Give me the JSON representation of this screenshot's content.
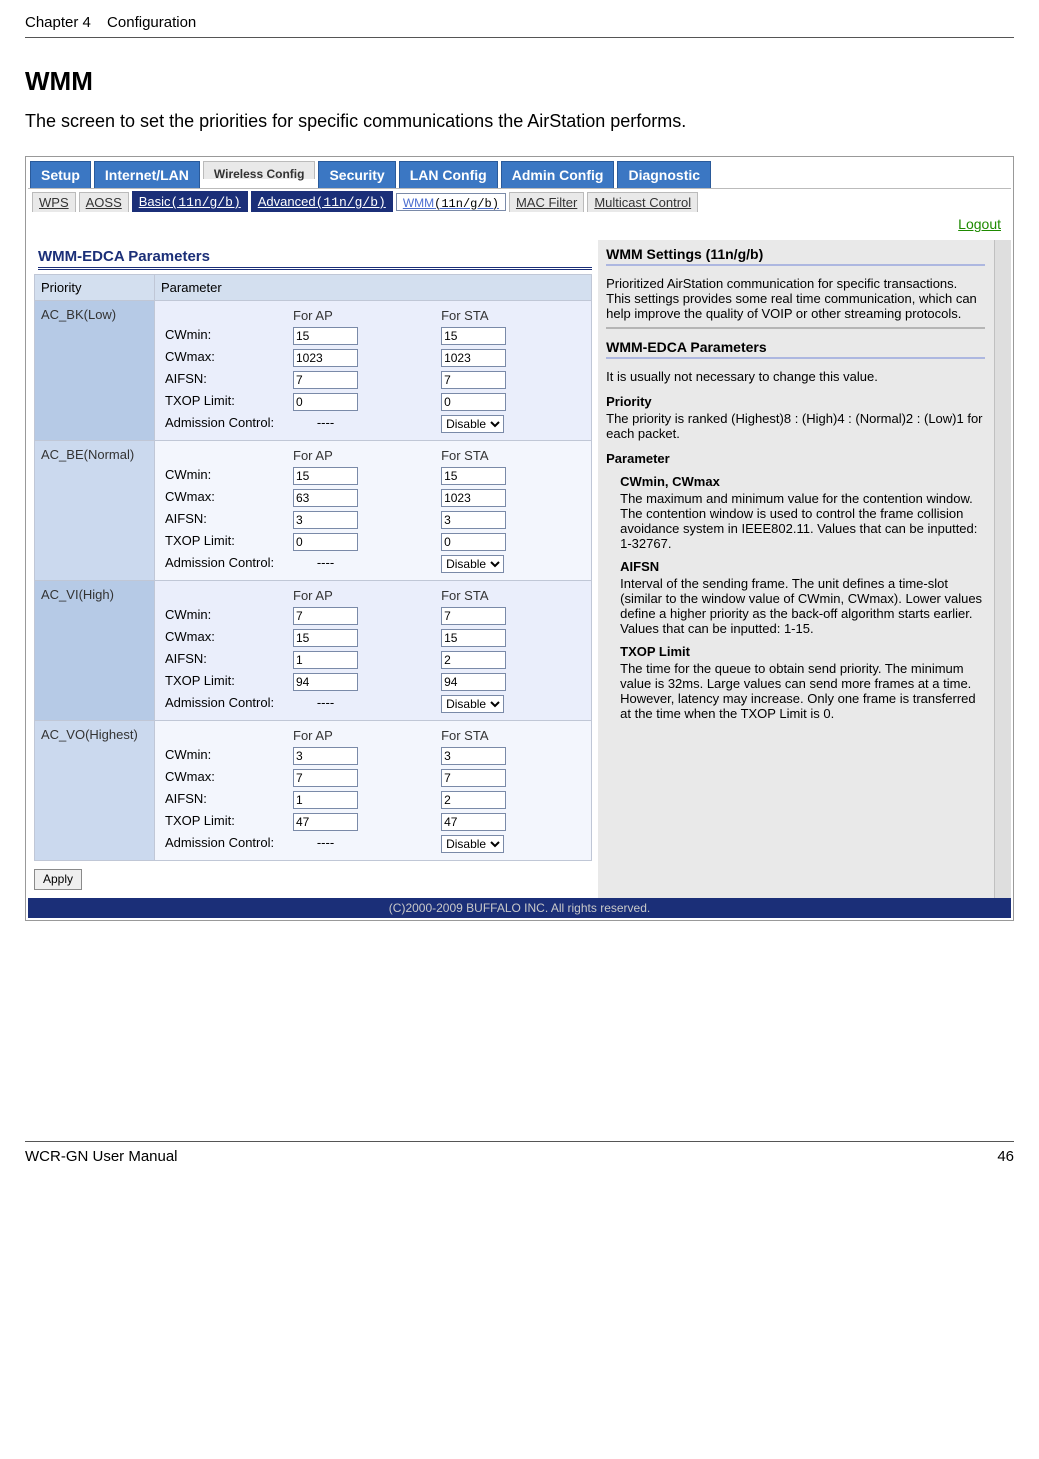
{
  "doc": {
    "chapter": "Chapter 4",
    "chapter_title": "Configuration",
    "section_title": "WMM",
    "intro": "The screen to set the priorities for specific communications the AirStation performs.",
    "footer_left": "WCR-GN User Manual",
    "footer_right": "46"
  },
  "app": {
    "tabs1": [
      "Setup",
      "Internet/LAN",
      "Wireless Config",
      "Security",
      "LAN Config",
      "Admin Config",
      "Diagnostic"
    ],
    "tabs1_selected": 2,
    "tabs2": [
      {
        "label": "WPS",
        "style": "light"
      },
      {
        "label": "AOSS",
        "style": "light"
      },
      {
        "label": "Basic",
        "mode": "(11n/g/b)",
        "style": "dark"
      },
      {
        "label": "Advanced",
        "mode": "(11n/g/b)",
        "style": "dark"
      },
      {
        "label": "WMM",
        "mode": "(11n/g/b)",
        "style": "selected"
      },
      {
        "label": "MAC Filter",
        "style": "light"
      },
      {
        "label": "Multicast Control",
        "style": "light"
      }
    ],
    "logout": "Logout",
    "bottombar": "(C)2000-2009 BUFFALO INC. All rights reserved."
  },
  "left": {
    "panel_title": "WMM-EDCA Parameters",
    "col_priority": "Priority",
    "col_parameter": "Parameter",
    "col_forap": "For AP",
    "col_forsta": "For STA",
    "row_labels": [
      "CWmin:",
      "CWmax:",
      "AIFSN:",
      "TXOP Limit:",
      "Admission Control:"
    ],
    "apply": "Apply",
    "admission_dashes": "----",
    "admission_select": "Disable",
    "priorities": [
      {
        "name": "AC_BK(Low)",
        "ap": [
          "15",
          "1023",
          "7",
          "0"
        ],
        "sta": [
          "15",
          "1023",
          "7",
          "0"
        ]
      },
      {
        "name": "AC_BE(Normal)",
        "ap": [
          "15",
          "63",
          "3",
          "0"
        ],
        "sta": [
          "15",
          "1023",
          "3",
          "0"
        ]
      },
      {
        "name": "AC_VI(High)",
        "ap": [
          "7",
          "15",
          "1",
          "94"
        ],
        "sta": [
          "7",
          "15",
          "2",
          "94"
        ]
      },
      {
        "name": "AC_VO(Highest)",
        "ap": [
          "3",
          "7",
          "1",
          "47"
        ],
        "sta": [
          "3",
          "7",
          "2",
          "47"
        ]
      }
    ]
  },
  "right": {
    "wmm_title": "WMM Settings (11n/g/b)",
    "wmm_desc": "Prioritized AirStation communication for specific transactions. This settings provides some real time communication, which can help improve the quality of VOIP or other streaming protocols.",
    "edca_title": "WMM-EDCA Parameters",
    "edca_desc": "It is usually not necessary to change this value.",
    "prio_h": "Priority",
    "prio_t": "The priority is ranked (Highest)8 : (High)4 : (Normal)2 : (Low)1 for each packet.",
    "param_h": "Parameter",
    "cw_h": "CWmin, CWmax",
    "cw_t": "The maximum and minimum value for the contention window. The contention window is used to control the frame collision avoidance system in IEEE802.11. Values that can be inputted: 1-32767.",
    "aifsn_h": "AIFSN",
    "aifsn_t": "Interval of the sending frame. The unit defines a time-slot (similar to the window value of CWmin, CWmax). Lower values define a higher priority as the back-off algorithm starts earlier. Values that can be inputted: 1-15.",
    "txop_h": "TXOP Limit",
    "txop_t": "The time for the queue to obtain send priority. The minimum value is 32ms. Large values can send more frames at a time. However, latency may increase. Only one frame is transferred at the time when the TXOP Limit is 0."
  }
}
